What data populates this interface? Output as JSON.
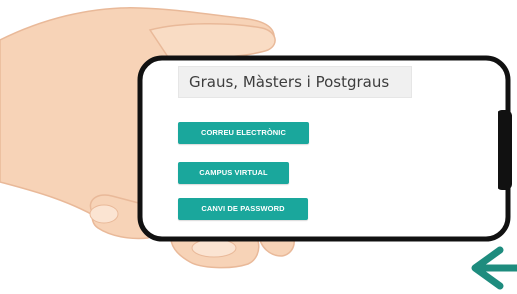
{
  "screen": {
    "title": "Graus, Màsters i Postgraus",
    "buttons": {
      "email": "CORREU ELECTRÒNIC",
      "campus": "CAMPUS VIRTUAL",
      "password": "CANVI DE PASSWORD"
    }
  },
  "colors": {
    "button": "#1aa79c",
    "arrow": "#1e8c7e",
    "skin": "#f7d3b7",
    "phone_frame": "#111111"
  },
  "icons": {
    "arrow": "arrow-left-icon"
  }
}
